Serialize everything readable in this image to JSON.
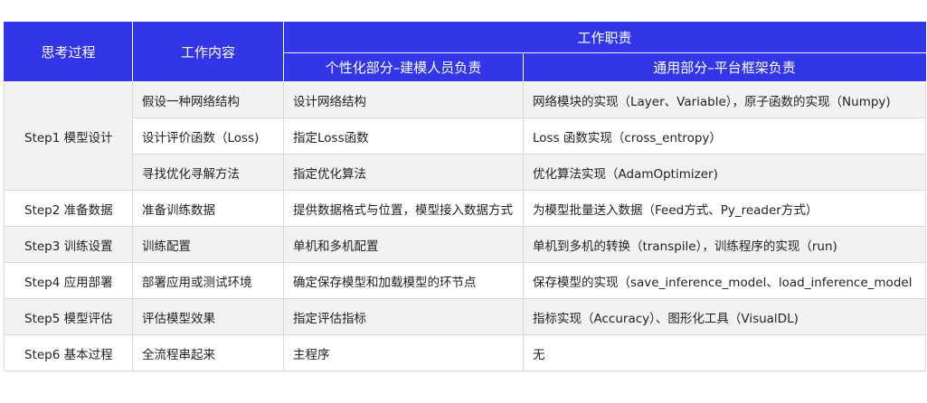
{
  "header": {
    "col_thinking": "思考过程",
    "col_work_content": "工作内容",
    "col_responsibility": "工作职责",
    "col_personalized": "个性化部分–建模人员负责",
    "col_common": "通用部分–平台框架负责"
  },
  "rows": [
    {
      "phase": "Step1  模型设计",
      "content": "假设一种网络结构",
      "personalized": "设计网络结构",
      "common": "网络模块的实现（Layer、Variable），原子函数的实现（Numpy)"
    },
    {
      "phase": "",
      "content": "设计评价函数（Loss)",
      "personalized": "指定Loss函数",
      "common": "Loss 函数实现（cross_entropy）"
    },
    {
      "phase": "",
      "content": " 寻找优化寻解方法",
      "personalized": "指定优化算法",
      "common": "优化算法实现（AdamOptimizer)"
    },
    {
      "phase": "Step2  准备数据",
      "content": "准备训练数据",
      "personalized": "提供数据格式与位置，模型接入数据方式",
      "common": "为模型批量送入数据（Feed方式、Py_reader方式）"
    },
    {
      "phase": "Step3  训练设置",
      "content": "训练配置",
      "personalized": "单机和多机配置",
      "common": "单机到多机的转换（transpile），训练程序的实现（run)"
    },
    {
      "phase": "Step4  应用部署",
      "content": "部署应用或测试环境",
      "personalized": "确定保存模型和加载模型的环节点",
      "common": "保存模型的实现（save_inference_model、load_inference_model"
    },
    {
      "phase": "Step5  模型评估",
      "content": "评估模型效果",
      "personalized": "指定评估指标",
      "common": "指标实现（Accuracy）、图形化工具（VisualDL)"
    },
    {
      "phase": "Step6  基本过程",
      "content": "全流程串起来",
      "personalized": "主程序",
      "common": "无"
    }
  ]
}
